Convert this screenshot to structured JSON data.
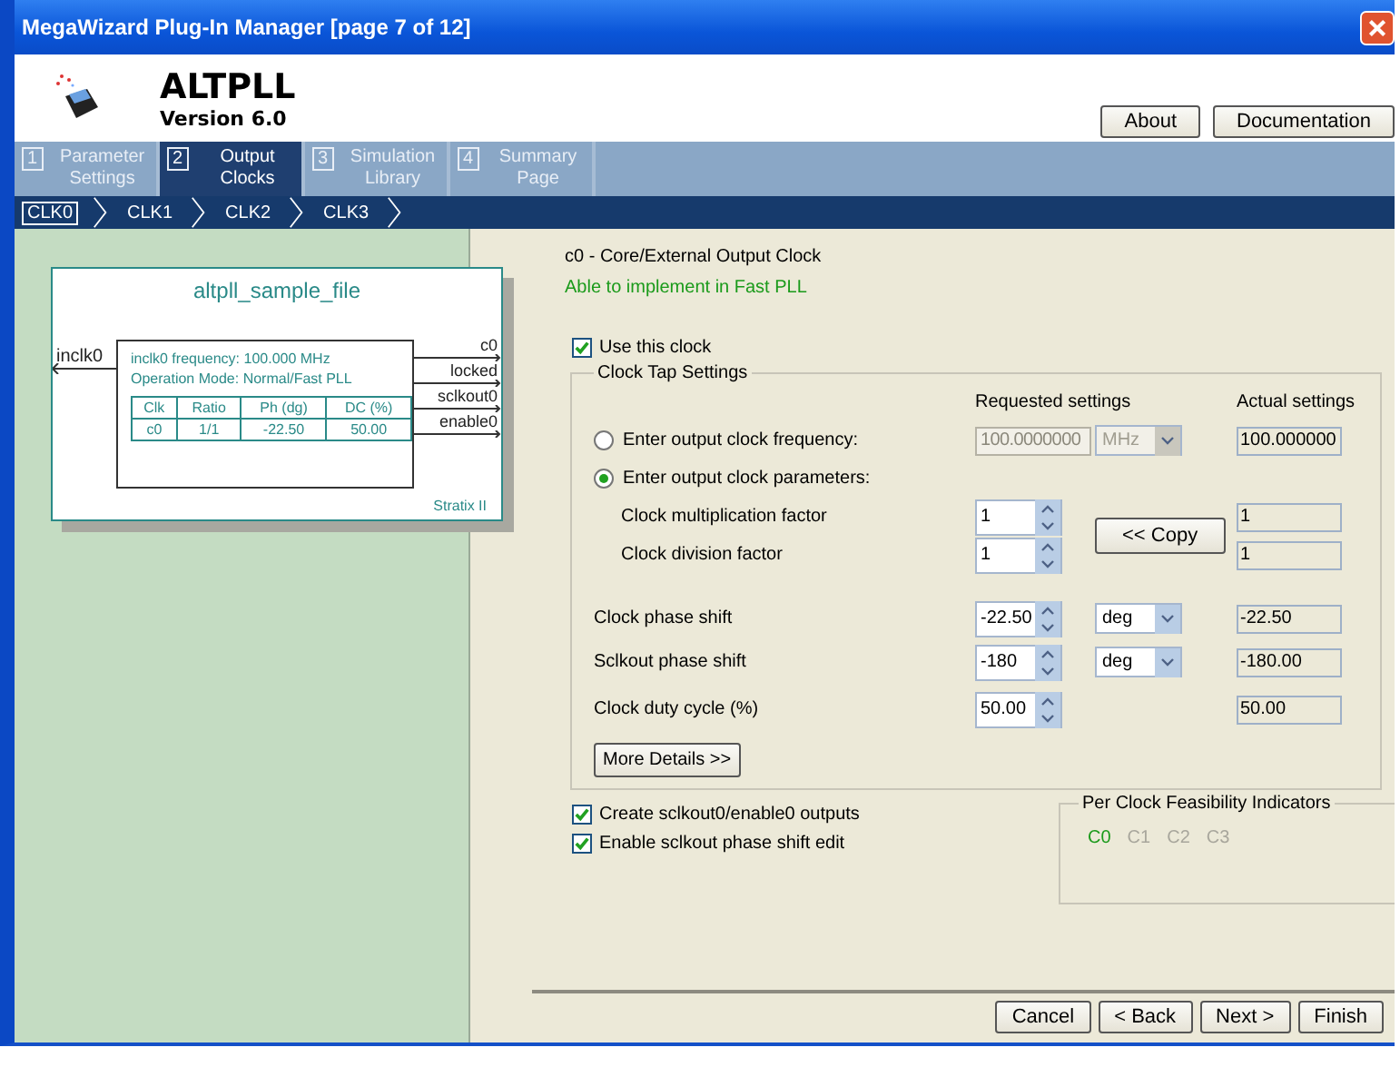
{
  "window": {
    "title": "MegaWizard Plug-In Manager [page 7 of 12]"
  },
  "header": {
    "title": "ALTPLL",
    "version": "Version 6.0"
  },
  "header_buttons": [
    "About",
    "Documentation"
  ],
  "tabs": [
    {
      "number": "1",
      "label": "Parameter Settings",
      "selected": false
    },
    {
      "number": "2",
      "label": "Output Clocks",
      "selected": true
    },
    {
      "number": "3",
      "label": "Simulation Library",
      "selected": false
    },
    {
      "number": "4",
      "label": "Summary Page",
      "selected": false
    }
  ],
  "clock_tabs": [
    {
      "label": "CLK0",
      "selected": true
    },
    {
      "label": "CLK1",
      "selected": false
    },
    {
      "label": "CLK2",
      "selected": false
    },
    {
      "label": "CLK3",
      "selected": false
    }
  ],
  "diagram": {
    "title": "altpll_sample_file",
    "input": "inclk0",
    "outputs": [
      "c0",
      "locked",
      "sclkout0",
      "enable0"
    ],
    "frequency": "inclk0 frequency: 100.000 MHz",
    "mode": "Operation Mode: Normal/Fast PLL",
    "table": {
      "columns": [
        "Clk",
        "Ratio",
        "Ph (dg)",
        "DC (%)"
      ],
      "rows": [
        [
          "c0",
          "1/1",
          "-22.50",
          "50.00"
        ]
      ]
    },
    "device": "Stratix II"
  },
  "panel": {
    "heading": "c0 - Core/External Output Clock",
    "status": "Able to implement in Fast PLL",
    "use_clock": {
      "label": "Use this clock",
      "checked": true
    }
  },
  "group": {
    "title": "Clock Tap Settings",
    "requested_header": "Requested settings",
    "actual_header": "Actual settings",
    "frequency_option": {
      "label": "Enter output clock frequency:",
      "selected": false,
      "disabled": true,
      "value": "100.0000000",
      "unit": "MHz",
      "actual": "100.000000"
    },
    "parameters_option": {
      "label": "Enter output clock parameters:",
      "selected": true
    },
    "rows": [
      {
        "kind": "factor",
        "label": "Clock multiplication factor",
        "value": "1",
        "actual": "1"
      },
      {
        "kind": "factor",
        "label": "Clock division factor",
        "value": "1",
        "actual": "1"
      },
      {
        "kind": "setting",
        "label": "Clock phase shift",
        "value": "-22.50",
        "unit": "deg",
        "actual": "-22.50"
      },
      {
        "kind": "setting",
        "label": "Sclkout phase shift",
        "value": "-180",
        "unit": "deg",
        "actual": "-180.00"
      },
      {
        "kind": "setting",
        "label": "Clock duty cycle (%)",
        "value": "50.00",
        "actual": "50.00"
      }
    ],
    "copy_button": "<< Copy",
    "details_button": "More Details >>"
  },
  "options": [
    {
      "label": "Create sclkout0/enable0 outputs",
      "checked": true
    },
    {
      "label": "Enable sclkout phase shift edit",
      "checked": true
    }
  ],
  "feasibility": {
    "title": "Per Clock Feasibility Indicators",
    "items": [
      {
        "label": "C0",
        "feasible": true
      },
      {
        "label": "C1",
        "feasible": false
      },
      {
        "label": "C2",
        "feasible": false
      },
      {
        "label": "C3",
        "feasible": false
      }
    ]
  },
  "buttons": [
    "Cancel",
    "< Back",
    "Next >",
    "Finish"
  ]
}
